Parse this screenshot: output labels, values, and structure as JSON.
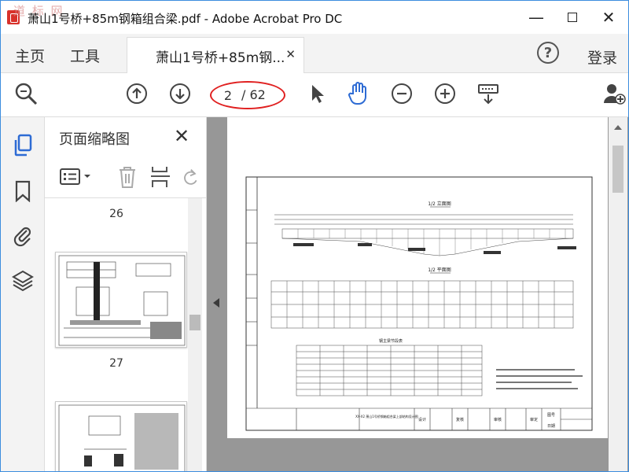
{
  "window": {
    "title": "萧山1号桥+85m钢箱组合梁.pdf - Adobe Acrobat Pro DC",
    "watermark": "道 标 网"
  },
  "menubar": {
    "home": "主页",
    "tools": "工具",
    "tab_label": "萧山1号桥+85m钢...",
    "login": "登录"
  },
  "toolbar": {
    "current_page": "2",
    "total_pages": "/ 62"
  },
  "thumbnail_panel": {
    "title": "页面缩略图",
    "page_labels": [
      "26",
      "27"
    ]
  },
  "document": {
    "section_elevation": "1/2 立面图",
    "section_plan": "1/2 平面图",
    "table_title": "钢主梁节段表",
    "project_name": "XX-X2 萧山1号桥钢箱组合梁上部结构设计图",
    "designer_label": "设计",
    "checker_label": "复核",
    "reviewer_label": "审核",
    "approver_label": "审定",
    "sheet_label": "图号",
    "date_label": "日期"
  },
  "colors": {
    "accent_blue": "#2d6bd4",
    "annotation_red": "#e02020",
    "canvas_gray": "#979797"
  }
}
